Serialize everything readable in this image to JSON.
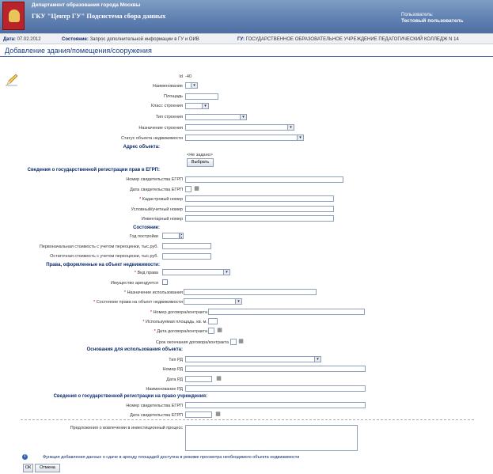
{
  "header": {
    "department": "Департамент образования города Москвы",
    "app_title": "ГКУ \"Центр ГУ\" Подсистема сбора данных",
    "user_label": "Пользователь:",
    "user_name": "Тестовый пользователь"
  },
  "infobar": {
    "date_label": "Дата:",
    "date_value": "07.02.2012",
    "state_label": "Состояние:",
    "state_value": "Запрос дополнительной информации в ГУ и ОИВ",
    "gu_label": "ГУ:",
    "gu_value": "ГОСУДАРСТВЕННОЕ ОБРАЗОВАТЕЛЬНОЕ УЧРЕЖДЕНИЕ ПЕДАГОГИЧЕСКИЙ КОЛЛЕДЖ N 14"
  },
  "page_title": "Добавление здания/помещения/сооружения",
  "form": {
    "id_label": "Id",
    "id_value": "-40",
    "name_label": "Наименование",
    "area_label": "Площадь",
    "building_class_label": "Класс строения",
    "building_type_label": "Тип строения",
    "building_purpose_label": "Назначение строения",
    "property_status_label": "Статус объекта недвижимости",
    "address_section": "Адрес объекта:",
    "address_value": "<Не задано>",
    "choose_button": "Выбрать",
    "egrp_section": "Сведения о государственной регистрации прав в ЕГРП:",
    "cert_number_label": "Номер свидетельства ЕГРП",
    "cert_date_label": "Дата свидетельства ЕГРП",
    "cadastral_label": "Кадастровый номер",
    "conditional_label": "Условный/учетный номер",
    "inventory_label": "Инвентарный номер",
    "state_section": "Состояние:",
    "build_year_label": "Год постройки",
    "initial_cost_label": "Первоначальная стоимость с учетом переоценки, тыс.руб.",
    "residual_cost_label": "Остаточная стоимость с учетом переоценки, тыс.руб.",
    "rights_section": "Права, оформленные на объект недвижимости:",
    "right_type_label": "Вид права",
    "leased_label": "Имущество арендуется",
    "usage_purpose_label": "Назначение использования",
    "right_state_label": "Состояние права на объект недвижимости",
    "contract_number_label": "Номер договора/контракта",
    "used_area_label": "Используемая площадь, кв. м.",
    "contract_date_label": "Дата договора/контракта",
    "contract_end_label": "Срок окончания договора/контракта",
    "basis_section": "Основания для использования объекта:",
    "rd_type_label": "Тип РД",
    "rd_number_label": "Номер РД",
    "rd_date_label": "Дата РД",
    "rd_name_label": "Наименование РД",
    "inst_section": "Сведения о государственной регистрации на право учреждения:",
    "inst_cert_number_label": "Номер свидетельства ЕГРП",
    "inst_cert_date_label": "Дата свидетельства ЕГРП",
    "investment_label": "Предложения о вовлечении в инвестиционный процесс"
  },
  "info_note": "Функция добавления данных о сдаче в аренду площадей доступна в режиме просмотра необходимого объекта недвижимости",
  "buttons": {
    "ok": "ОК",
    "cancel": "Отмена"
  },
  "icons": {
    "pencil": "pencil-icon",
    "calendar": "calendar-icon",
    "info": "info-icon",
    "dropdown": "chevron-down-icon"
  },
  "colors": {
    "header": "#5e7fb0",
    "section_text": "#0e2c6b",
    "title": "#1b3e87",
    "required": "#cc0000"
  }
}
